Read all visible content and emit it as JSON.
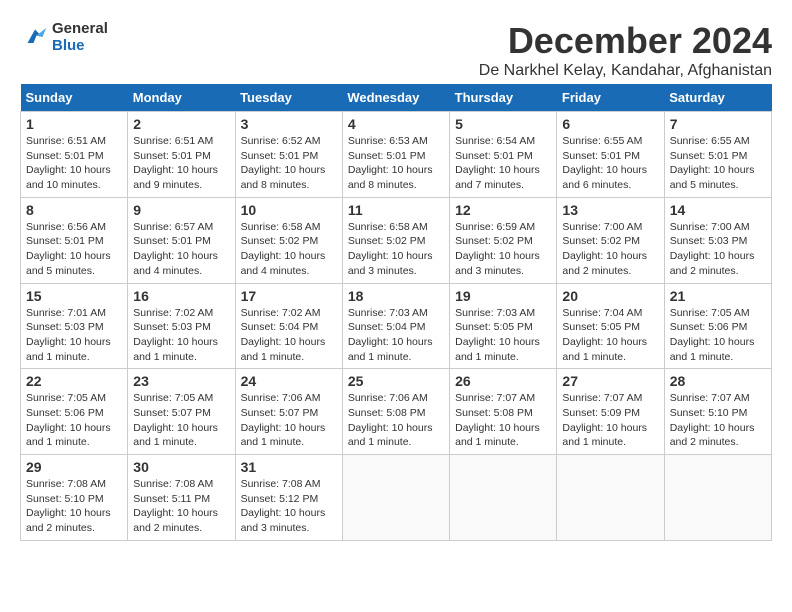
{
  "logo": {
    "line1": "General",
    "line2": "Blue"
  },
  "title": "December 2024",
  "location": "De Narkhel Kelay, Kandahar, Afghanistan",
  "days_header": [
    "Sunday",
    "Monday",
    "Tuesday",
    "Wednesday",
    "Thursday",
    "Friday",
    "Saturday"
  ],
  "weeks": [
    [
      {
        "num": "1",
        "sunrise": "6:51 AM",
        "sunset": "5:01 PM",
        "daylight": "10 hours and 10 minutes."
      },
      {
        "num": "2",
        "sunrise": "6:51 AM",
        "sunset": "5:01 PM",
        "daylight": "10 hours and 9 minutes."
      },
      {
        "num": "3",
        "sunrise": "6:52 AM",
        "sunset": "5:01 PM",
        "daylight": "10 hours and 8 minutes."
      },
      {
        "num": "4",
        "sunrise": "6:53 AM",
        "sunset": "5:01 PM",
        "daylight": "10 hours and 8 minutes."
      },
      {
        "num": "5",
        "sunrise": "6:54 AM",
        "sunset": "5:01 PM",
        "daylight": "10 hours and 7 minutes."
      },
      {
        "num": "6",
        "sunrise": "6:55 AM",
        "sunset": "5:01 PM",
        "daylight": "10 hours and 6 minutes."
      },
      {
        "num": "7",
        "sunrise": "6:55 AM",
        "sunset": "5:01 PM",
        "daylight": "10 hours and 5 minutes."
      }
    ],
    [
      {
        "num": "8",
        "sunrise": "6:56 AM",
        "sunset": "5:01 PM",
        "daylight": "10 hours and 5 minutes."
      },
      {
        "num": "9",
        "sunrise": "6:57 AM",
        "sunset": "5:01 PM",
        "daylight": "10 hours and 4 minutes."
      },
      {
        "num": "10",
        "sunrise": "6:58 AM",
        "sunset": "5:02 PM",
        "daylight": "10 hours and 4 minutes."
      },
      {
        "num": "11",
        "sunrise": "6:58 AM",
        "sunset": "5:02 PM",
        "daylight": "10 hours and 3 minutes."
      },
      {
        "num": "12",
        "sunrise": "6:59 AM",
        "sunset": "5:02 PM",
        "daylight": "10 hours and 3 minutes."
      },
      {
        "num": "13",
        "sunrise": "7:00 AM",
        "sunset": "5:02 PM",
        "daylight": "10 hours and 2 minutes."
      },
      {
        "num": "14",
        "sunrise": "7:00 AM",
        "sunset": "5:03 PM",
        "daylight": "10 hours and 2 minutes."
      }
    ],
    [
      {
        "num": "15",
        "sunrise": "7:01 AM",
        "sunset": "5:03 PM",
        "daylight": "10 hours and 1 minute."
      },
      {
        "num": "16",
        "sunrise": "7:02 AM",
        "sunset": "5:03 PM",
        "daylight": "10 hours and 1 minute."
      },
      {
        "num": "17",
        "sunrise": "7:02 AM",
        "sunset": "5:04 PM",
        "daylight": "10 hours and 1 minute."
      },
      {
        "num": "18",
        "sunrise": "7:03 AM",
        "sunset": "5:04 PM",
        "daylight": "10 hours and 1 minute."
      },
      {
        "num": "19",
        "sunrise": "7:03 AM",
        "sunset": "5:05 PM",
        "daylight": "10 hours and 1 minute."
      },
      {
        "num": "20",
        "sunrise": "7:04 AM",
        "sunset": "5:05 PM",
        "daylight": "10 hours and 1 minute."
      },
      {
        "num": "21",
        "sunrise": "7:05 AM",
        "sunset": "5:06 PM",
        "daylight": "10 hours and 1 minute."
      }
    ],
    [
      {
        "num": "22",
        "sunrise": "7:05 AM",
        "sunset": "5:06 PM",
        "daylight": "10 hours and 1 minute."
      },
      {
        "num": "23",
        "sunrise": "7:05 AM",
        "sunset": "5:07 PM",
        "daylight": "10 hours and 1 minute."
      },
      {
        "num": "24",
        "sunrise": "7:06 AM",
        "sunset": "5:07 PM",
        "daylight": "10 hours and 1 minute."
      },
      {
        "num": "25",
        "sunrise": "7:06 AM",
        "sunset": "5:08 PM",
        "daylight": "10 hours and 1 minute."
      },
      {
        "num": "26",
        "sunrise": "7:07 AM",
        "sunset": "5:08 PM",
        "daylight": "10 hours and 1 minute."
      },
      {
        "num": "27",
        "sunrise": "7:07 AM",
        "sunset": "5:09 PM",
        "daylight": "10 hours and 1 minute."
      },
      {
        "num": "28",
        "sunrise": "7:07 AM",
        "sunset": "5:10 PM",
        "daylight": "10 hours and 2 minutes."
      }
    ],
    [
      {
        "num": "29",
        "sunrise": "7:08 AM",
        "sunset": "5:10 PM",
        "daylight": "10 hours and 2 minutes."
      },
      {
        "num": "30",
        "sunrise": "7:08 AM",
        "sunset": "5:11 PM",
        "daylight": "10 hours and 2 minutes."
      },
      {
        "num": "31",
        "sunrise": "7:08 AM",
        "sunset": "5:12 PM",
        "daylight": "10 hours and 3 minutes."
      },
      null,
      null,
      null,
      null
    ]
  ],
  "labels": {
    "sunrise": "Sunrise:",
    "sunset": "Sunset:",
    "daylight": "Daylight:"
  }
}
